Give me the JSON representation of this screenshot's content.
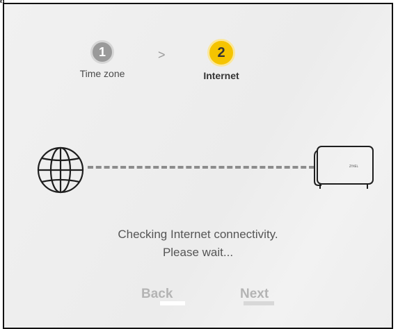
{
  "stepper": {
    "steps": [
      {
        "number": "1",
        "label": "Time zone"
      },
      {
        "number": "2",
        "label": "Internet"
      }
    ],
    "separator": ">"
  },
  "diagram": {
    "left_icon": "globe-icon",
    "right_icon": "router-icon"
  },
  "status": {
    "line1": "Checking Internet connectivity.",
    "line2": "Please wait..."
  },
  "buttons": {
    "back_label": "Back",
    "next_label": "Next"
  },
  "colors": {
    "active_step": "#f5c400",
    "done_step": "#9a9a9a",
    "disabled_text": "#b4b4b4"
  }
}
